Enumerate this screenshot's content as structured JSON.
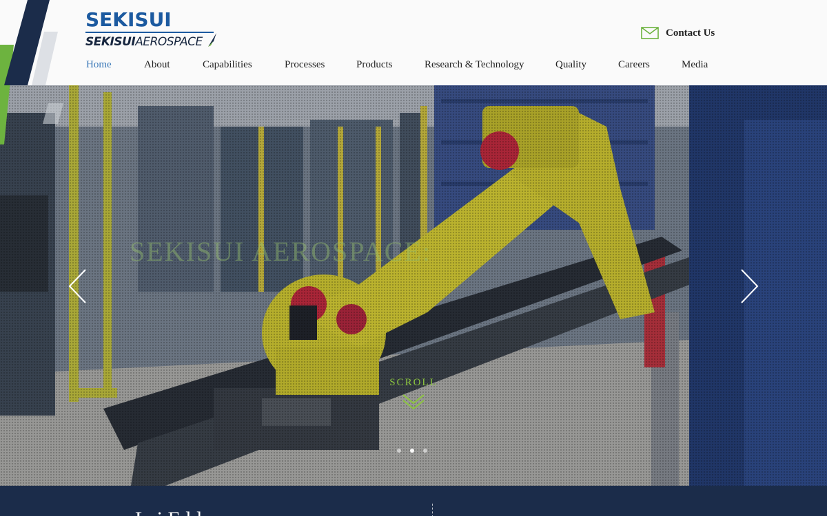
{
  "brand": {
    "logo_top": "SEKISUI",
    "logo_bottom_bold": "SEKISUI",
    "logo_bottom_thin": "AEROSPACE",
    "color_primary": "#1c5aa0",
    "color_accent": "#8cc63f",
    "color_dark": "#1b2c4a"
  },
  "header": {
    "contact_label": "Contact Us",
    "contact_icon": "envelope-icon"
  },
  "nav": {
    "items": [
      {
        "label": "Home",
        "active": true
      },
      {
        "label": "About"
      },
      {
        "label": "Capabilities"
      },
      {
        "label": "Processes"
      },
      {
        "label": "Products"
      },
      {
        "label": "Research & Technology"
      },
      {
        "label": "Quality"
      },
      {
        "label": "Careers"
      },
      {
        "label": "Media"
      }
    ]
  },
  "hero": {
    "title": "SEKISUI AEROSPACE:",
    "prev_icon": "chevron-left-icon",
    "next_icon": "chevron-right-icon",
    "scroll_label": "SCROLL",
    "scroll_icon": "double-chevron-down-icon",
    "slide_count": 3,
    "active_slide": 2
  },
  "band": {
    "text": "Lai       E   l       l"
  }
}
